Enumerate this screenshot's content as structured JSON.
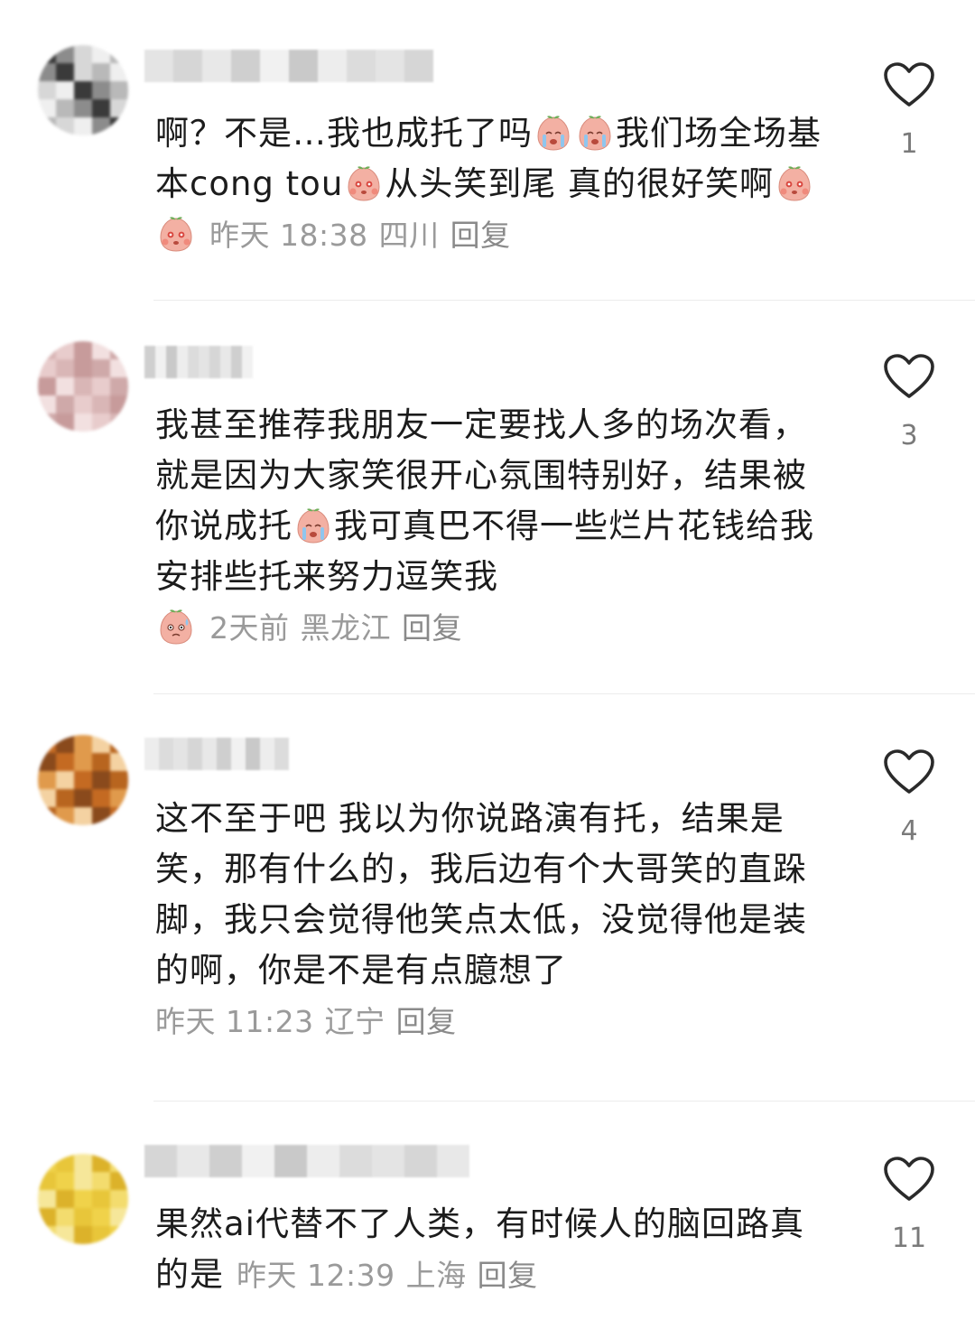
{
  "comments": [
    {
      "text_parts": [
        "啊？不是…我也成托了吗",
        "我们场全场基本cong tou",
        "从头笑到尾 真的很好笑啊"
      ],
      "time": "昨天 18:38",
      "location": "四川",
      "reply_label": "回复",
      "like_count": "1",
      "avatar_colors": [
        "#3a3a3a",
        "#8c8c8c",
        "#d7d7d7",
        "#efefef",
        "#b9b9b9"
      ]
    },
    {
      "text_parts": [
        "我甚至推荐我朋友一定要找人多的场次看，就是因为大家笑很开心氛围特别好，结果被你说成托",
        "我可真巴不得一些烂片花钱给我安排些托来努力逗笑我"
      ],
      "time": "2天前",
      "location": "黑龙江",
      "reply_label": "回复",
      "like_count": "3",
      "avatar_colors": [
        "#d9b6b6",
        "#e8cccc",
        "#c79b9b",
        "#f2e0e0",
        "#cfa9a9"
      ]
    },
    {
      "text": "这不至于吧 我以为你说路演有托，结果是笑，那有什么的，我后边有个大哥笑的直跺脚，我只会觉得他笑点太低，没觉得他是装的啊，你是不是有点臆想了",
      "time": "昨天 11:23",
      "location": "辽宁",
      "reply_label": "回复",
      "like_count": "4",
      "avatar_colors": [
        "#c46a22",
        "#8a4a1c",
        "#e09a4c",
        "#f4d2a2",
        "#b8651f"
      ]
    },
    {
      "text": "果然ai代替不了人类，有时候人的脑回路真的是",
      "time": "昨天 12:39",
      "location": "上海",
      "reply_label": "回复",
      "like_count": "11",
      "avatar_colors": [
        "#f0d24a",
        "#e8c63a",
        "#f6e79a",
        "#dcb22a",
        "#f3dc6e"
      ]
    }
  ],
  "colors": {
    "meta_text": "#9a9a9a",
    "content_text": "#1c1c1c",
    "divider": "#ececec",
    "emoji_face": "#f3b0a3",
    "emoji_leaf": "#6fae5a"
  },
  "icons": {
    "like": "heart-outline-icon",
    "emoji": "peach-face-emoji-icon"
  }
}
